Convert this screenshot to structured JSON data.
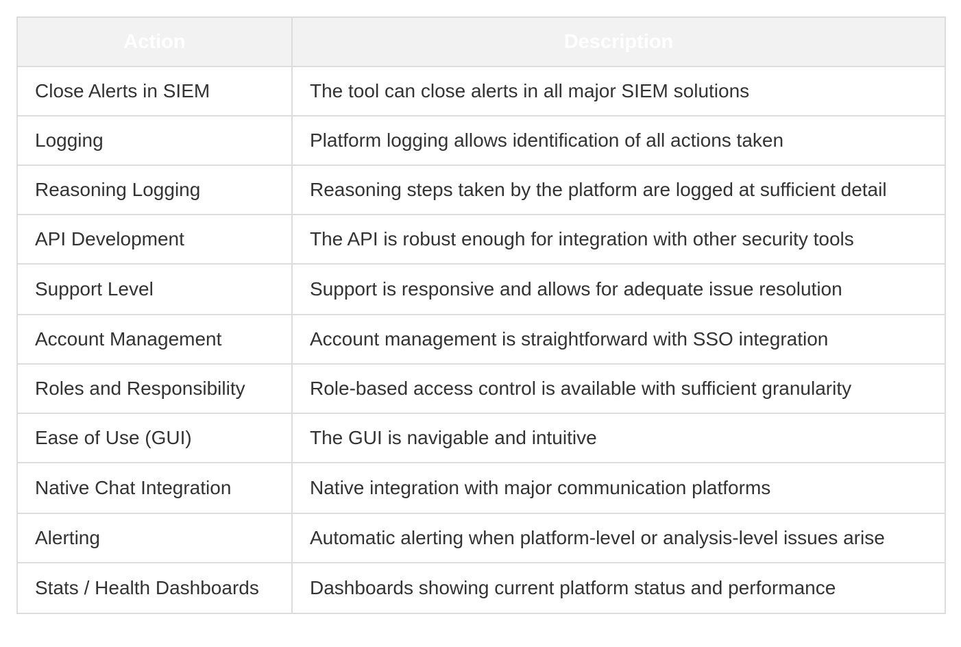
{
  "table": {
    "headers": [
      "Action",
      "Description"
    ],
    "rows": [
      {
        "action": "Close Alerts in SIEM",
        "description": "The tool can close alerts in all major SIEM solutions"
      },
      {
        "action": "Logging",
        "description": "Platform logging allows identification of all actions taken"
      },
      {
        "action": "Reasoning Logging",
        "description": "Reasoning steps taken by the platform are logged at sufficient detail"
      },
      {
        "action": "API Development",
        "description": "The API is robust enough for integration with other security tools"
      },
      {
        "action": "Support Level",
        "description": "Support is responsive and allows for adequate issue resolution"
      },
      {
        "action": "Account Management",
        "description": "Account management is straightforward with SSO integration"
      },
      {
        "action": "Roles and Responsibility",
        "description": "Role-based access control is available with sufficient granularity"
      },
      {
        "action": "Ease of Use (GUI)",
        "description": "The GUI is navigable and intuitive"
      },
      {
        "action": "Native Chat Integration",
        "description": "Native integration with major communication platforms"
      },
      {
        "action": "Alerting",
        "description": "Automatic alerting when platform-level or analysis-level issues arise"
      },
      {
        "action": "Stats / Health Dashboards",
        "description": "Dashboards showing current platform status and performance"
      }
    ]
  },
  "colors": {
    "header_background": "#f2f2f2",
    "header_text": "#ffffff",
    "border": "#dcdcdc",
    "body_text": "#333333"
  }
}
